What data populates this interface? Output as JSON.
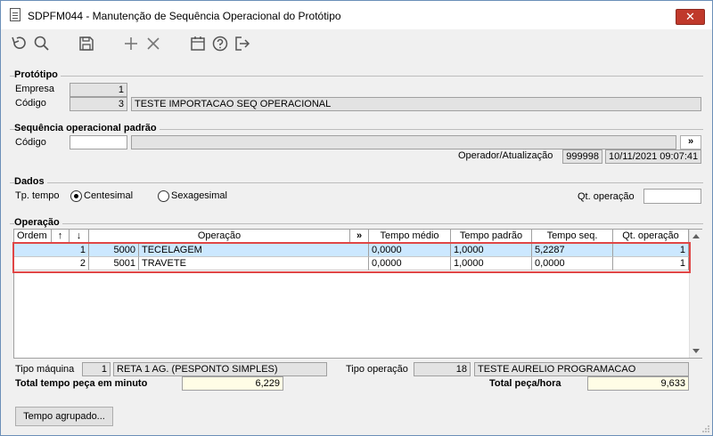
{
  "window": {
    "title": "SDPFM044 - Manutenção de Sequência Operacional do Protótipo",
    "close_glyph": "✕"
  },
  "prototipo": {
    "section_title": "Protótipo",
    "empresa_label": "Empresa",
    "empresa_value": "1",
    "codigo_label": "Código",
    "codigo_value": "3",
    "descricao": "TESTE IMPORTACAO SEQ OPERACIONAL"
  },
  "sequencia": {
    "section_title": "Sequência operacional padrão",
    "codigo_label": "Código",
    "codigo_value": "",
    "descricao": "",
    "lookup_label": "»",
    "operador_label": "Operador/Atualização",
    "operador_value": "999998",
    "atualizacao_value": "10/11/2021 09:07:41"
  },
  "dados": {
    "section_title": "Dados",
    "tp_tempo_label": "Tp. tempo",
    "opt_centesimal": "Centesimal",
    "opt_sexagesimal": "Sexagesimal",
    "selected": "Centesimal",
    "qt_operacao_label": "Qt. operação",
    "qt_operacao_value": ""
  },
  "operacao": {
    "section_title": "Operação",
    "columns": {
      "ordem": "Ordem",
      "up": "↑",
      "down": "↓",
      "operacao": "Operação",
      "lookup": "»",
      "tempo_medio": "Tempo médio",
      "tempo_padrao": "Tempo padrão",
      "tempo_seq": "Tempo seq.",
      "qt_operacao": "Qt. operação"
    },
    "rows": [
      {
        "ordem": "1",
        "codigo": "5000",
        "operacao": "TECELAGEM",
        "tempo_medio": "0,0000",
        "tempo_padrao": "1,0000",
        "tempo_seq": "5,2287",
        "qt_operacao": "1"
      },
      {
        "ordem": "2",
        "codigo": "5001",
        "operacao": "TRAVETE",
        "tempo_medio": "0,0000",
        "tempo_padrao": "1,0000",
        "tempo_seq": "0,0000",
        "qt_operacao": "1"
      }
    ]
  },
  "footer": {
    "tipo_maquina_label": "Tipo máquina",
    "tipo_maquina_code": "1",
    "tipo_maquina_desc": "RETA 1 AG. (PESPONTO SIMPLES)",
    "tipo_operacao_label": "Tipo operação",
    "tipo_operacao_code": "18",
    "tipo_operacao_desc": "TESTE AURELIO PROGRAMACAO",
    "total_tempo_label": "Total tempo peça em minuto",
    "total_tempo_value": "6,229",
    "total_peca_label": "Total peça/hora",
    "total_peca_value": "9,633",
    "tempo_agrupado_button": "Tempo agrupado..."
  },
  "toolbar": {
    "icons": [
      "undo-icon",
      "search-icon",
      "save-icon",
      "add-icon",
      "delete-icon",
      "calendar-icon",
      "help-icon",
      "exit-icon"
    ]
  },
  "colors": {
    "selected_row": "#cce8ff",
    "highlight_box": "#e04646",
    "close_button": "#c0392b",
    "total_field": "#fffde6"
  }
}
